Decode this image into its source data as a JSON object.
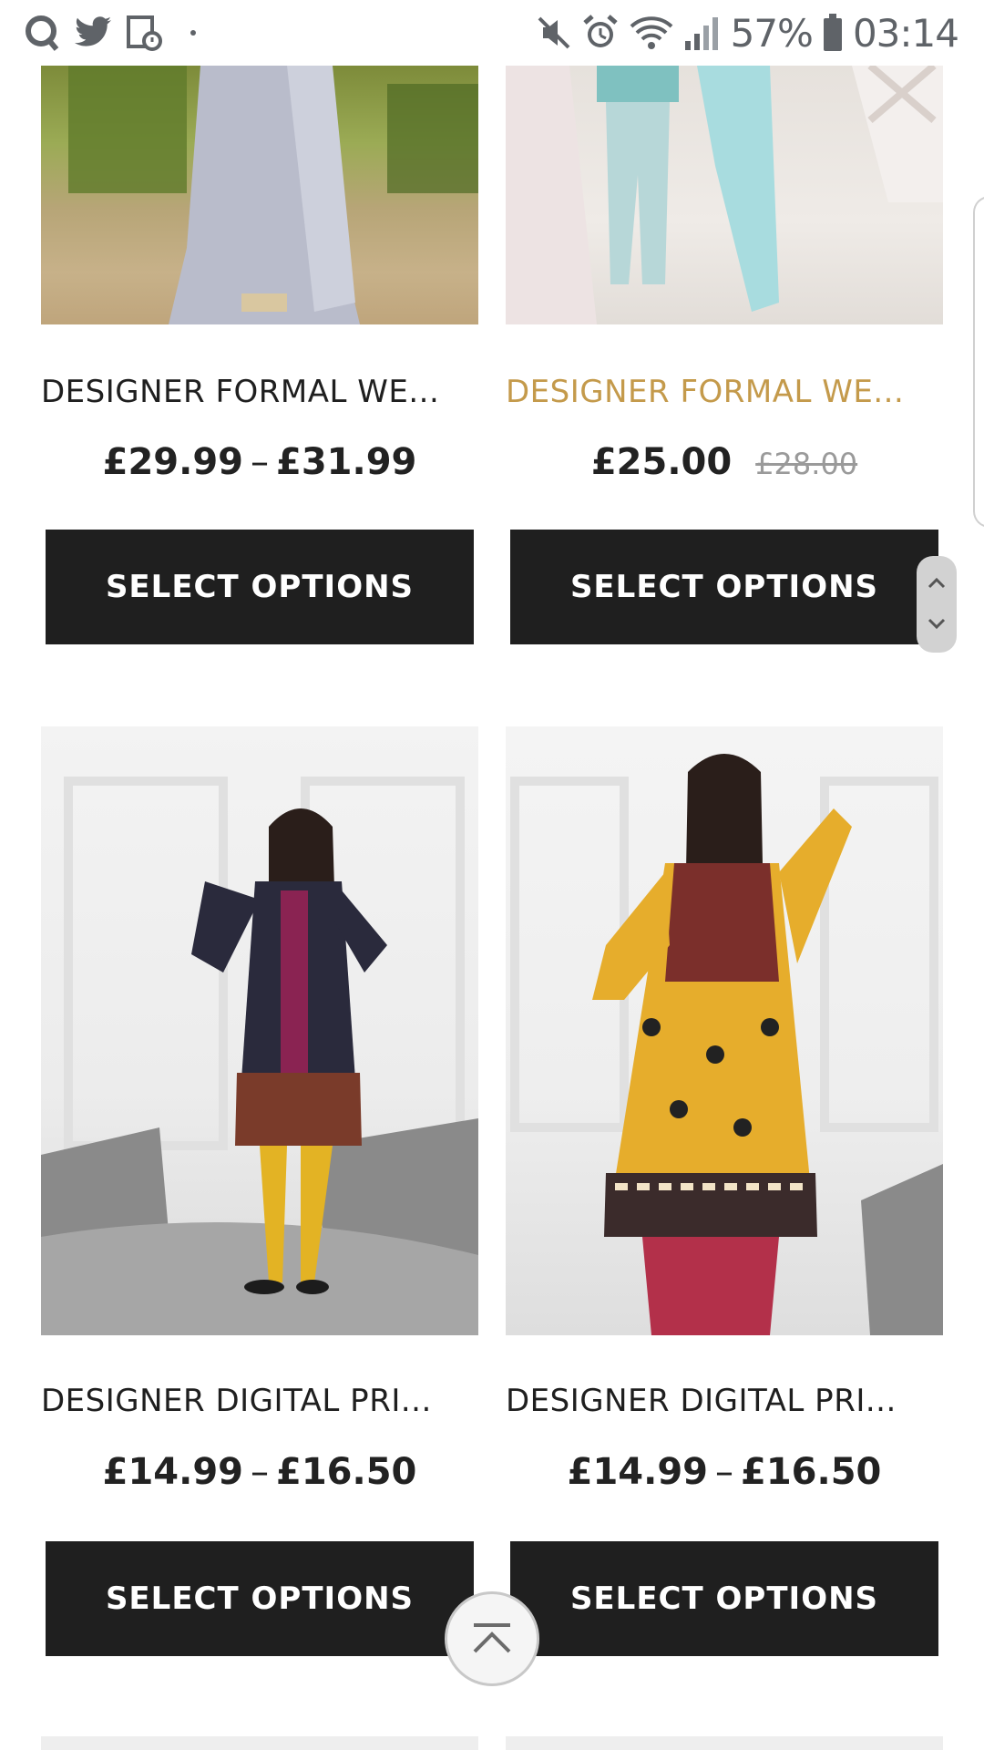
{
  "status_bar": {
    "battery": "57%",
    "time": "03:14",
    "icons": [
      "q-app-icon",
      "twitter-icon",
      "calendar-clock-icon",
      "dot-icon",
      "mute-icon",
      "alarm-icon",
      "wifi-icon",
      "signal-icon",
      "battery-icon"
    ]
  },
  "products": [
    {
      "title": "DESIGNER FORMAL WE...",
      "price_low": "£29.99",
      "price_sep": "–",
      "price_high": "£31.99",
      "button": "SELECT OPTIONS"
    },
    {
      "title": "DESIGNER FORMAL WE...",
      "price_sale": "£25.00",
      "price_old": "£28.00",
      "button": "SELECT OPTIONS",
      "title_color": "#c49a4b"
    },
    {
      "title": "DESIGNER DIGITAL PRI...",
      "price_low": "£14.99",
      "price_sep": "–",
      "price_high": "£16.50",
      "button": "SELECT OPTIONS"
    },
    {
      "title": "DESIGNER DIGITAL PRI...",
      "price_low": "£14.99",
      "price_sep": "–",
      "price_high": "£16.50",
      "button": "SELECT OPTIONS"
    }
  ],
  "controls": {
    "scroll_icons": [
      "chevron-up-icon",
      "chevron-down-icon"
    ],
    "back_to_top_icon": "back-to-top-icon"
  }
}
